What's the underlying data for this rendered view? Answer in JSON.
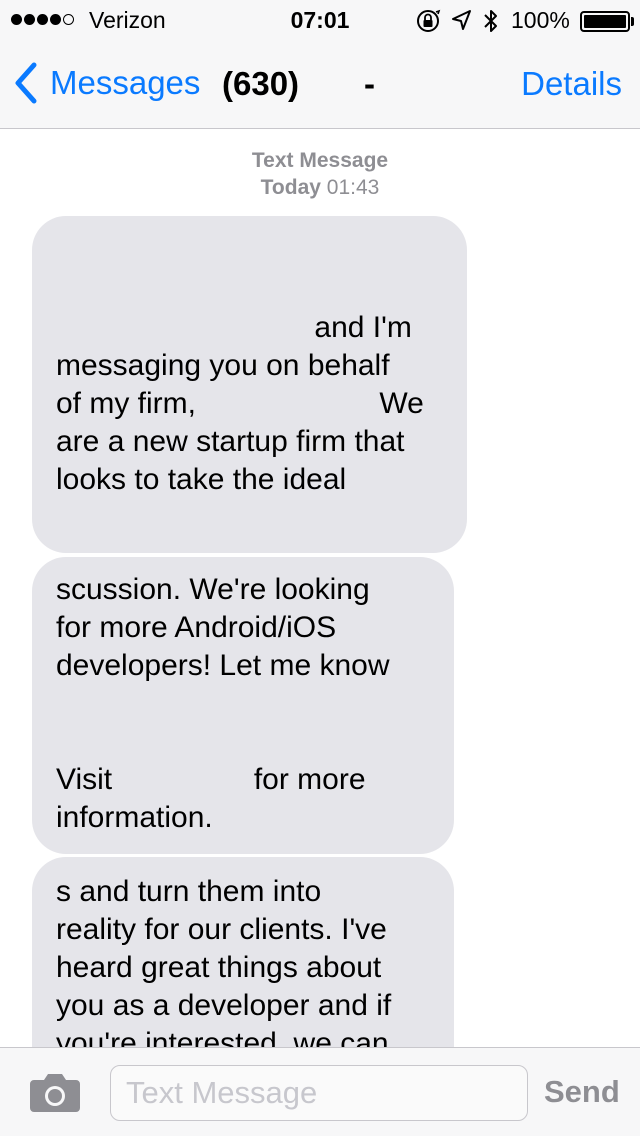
{
  "status_bar": {
    "carrier": "Verizon",
    "signal_bars_filled": 4,
    "signal_bars_total": 5,
    "time": "07:01",
    "icons": [
      "rotation-lock-icon",
      "location-arrow-icon",
      "bluetooth-icon"
    ],
    "battery_percent": "100%",
    "battery_level": 1.0
  },
  "nav": {
    "back_label": "Messages",
    "unread_count": "(630)",
    "title": "-",
    "details_label": "Details",
    "accent_color": "#0a7aff"
  },
  "conversation": {
    "header_kind": "Text Message",
    "header_day": "Today",
    "header_time": "01:43",
    "messages": [
      {
        "lines": [
          "",
          "                               and I'm",
          "messaging you on behalf",
          "of my firm,                      We",
          "are a new startup firm that",
          "looks to take the ideal"
        ]
      },
      {
        "lines": [
          "scussion. We're looking",
          "for more Android/iOS",
          "developers! Let me know",
          "",
          "",
          "Visit                 for more",
          "information."
        ]
      },
      {
        "lines": [
          "s and turn them into",
          "reality for our clients. I've",
          "heard great things about",
          "you as a developer and if",
          "you're interested, we can"
        ]
      }
    ],
    "bubble_color": "#e5e5ea"
  },
  "composer": {
    "camera_icon": "camera-icon",
    "placeholder": "Text Message",
    "value": "",
    "send_label": "Send"
  }
}
